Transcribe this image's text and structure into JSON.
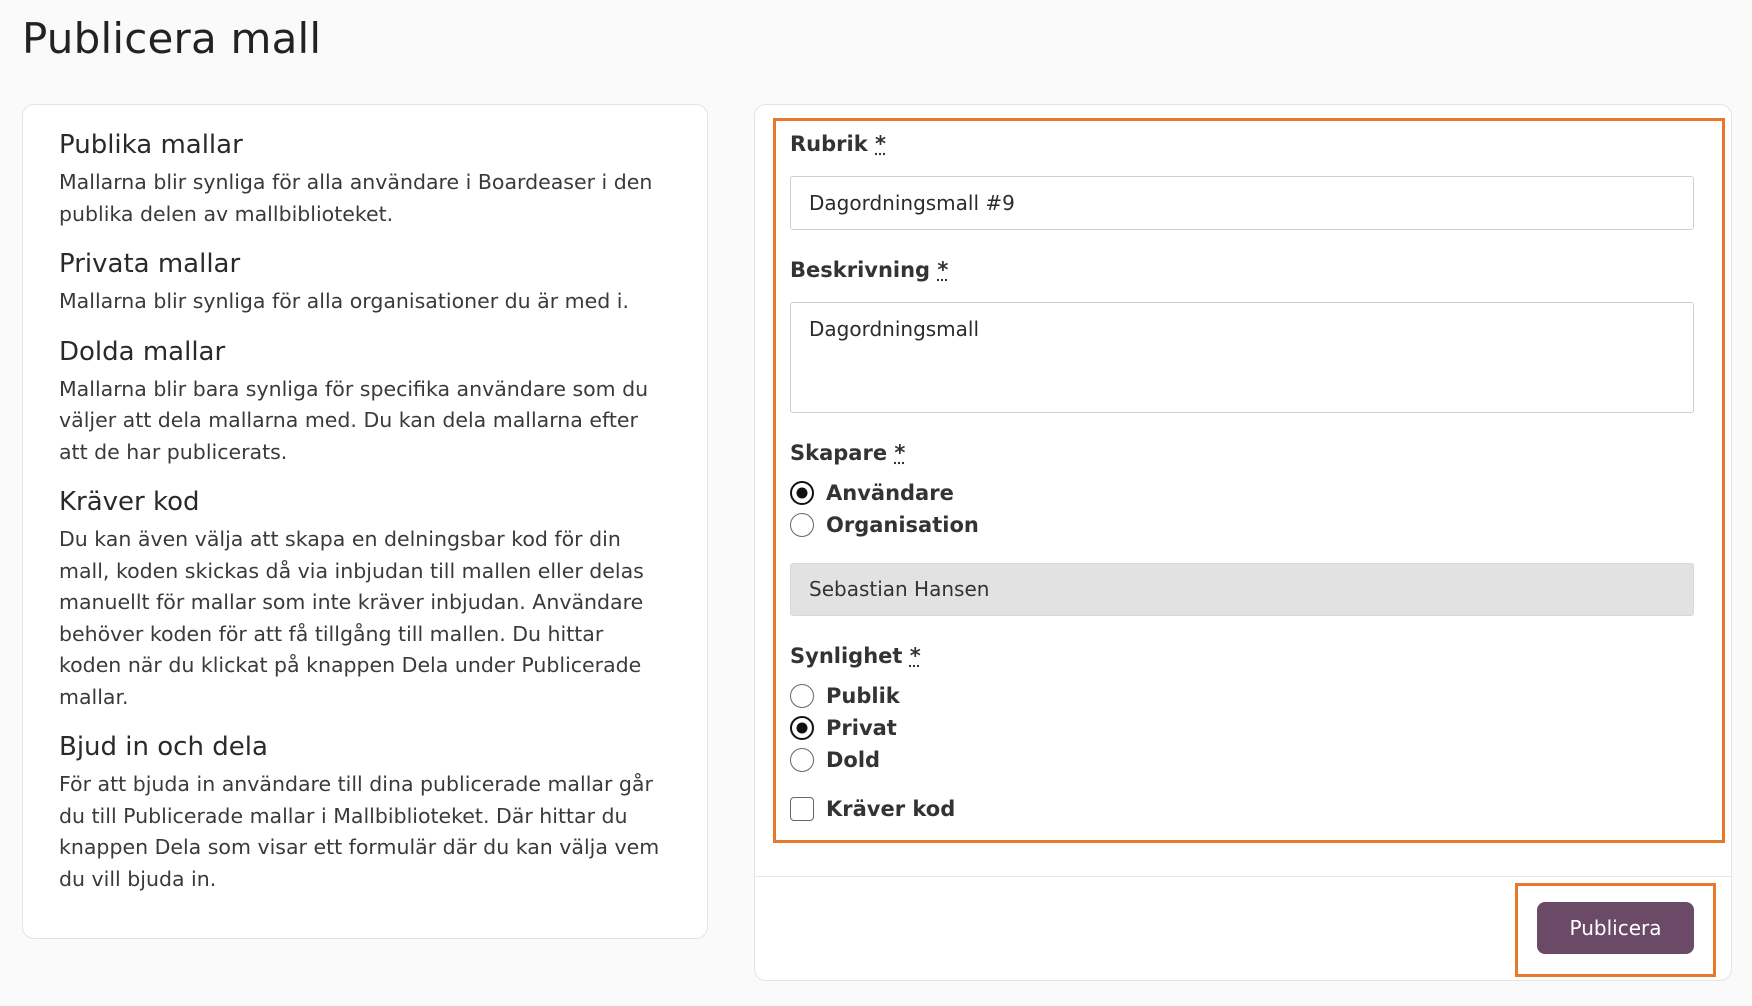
{
  "page": {
    "title": "Publicera mall"
  },
  "info": {
    "sections": [
      {
        "heading": "Publika mallar",
        "text": "Mallarna blir synliga för alla användare i Boardeaser i den publika delen av mallbiblioteket."
      },
      {
        "heading": "Privata mallar",
        "text": "Mallarna blir synliga för alla organisationer du är med i."
      },
      {
        "heading": "Dolda mallar",
        "text": "Mallarna blir bara synliga för specifika användare som du väljer att dela mallarna med. Du kan dela mallarna efter att de har publicerats."
      },
      {
        "heading": "Kräver kod",
        "text": "Du kan även välja att skapa en delningsbar kod för din mall, koden skickas då via inbjudan till mallen eller delas manuellt för mallar som inte kräver inbjudan. Användare behöver koden för att få tillgång till mallen. Du hittar koden när du klickat på knappen Dela under Publicerade mallar."
      },
      {
        "heading": "Bjud in och dela",
        "text": "För att bjuda in användare till dina publicerade mallar går du till Publicerade mallar i Mallbiblioteket. Där hittar du knappen Dela som visar ett formulär där du kan välja vem du vill bjuda in."
      }
    ]
  },
  "form": {
    "required_marker": "*",
    "title_field": {
      "label": "Rubrik",
      "value": "Dagordningsmall #9"
    },
    "description_field": {
      "label": "Beskrivning",
      "value": "Dagordningsmall"
    },
    "creator": {
      "label": "Skapare",
      "options": [
        {
          "label": "Användare",
          "checked": true
        },
        {
          "label": "Organisation",
          "checked": false
        }
      ],
      "selected_name": "Sebastian Hansen"
    },
    "visibility": {
      "label": "Synlighet",
      "options": [
        {
          "label": "Publik",
          "checked": false
        },
        {
          "label": "Privat",
          "checked": true
        },
        {
          "label": "Dold",
          "checked": false
        }
      ]
    },
    "requires_code": {
      "label": "Kräver kod",
      "checked": false
    },
    "submit_label": "Publicera"
  },
  "colors": {
    "highlight": "#e8782c",
    "button": "#6b4a68"
  }
}
